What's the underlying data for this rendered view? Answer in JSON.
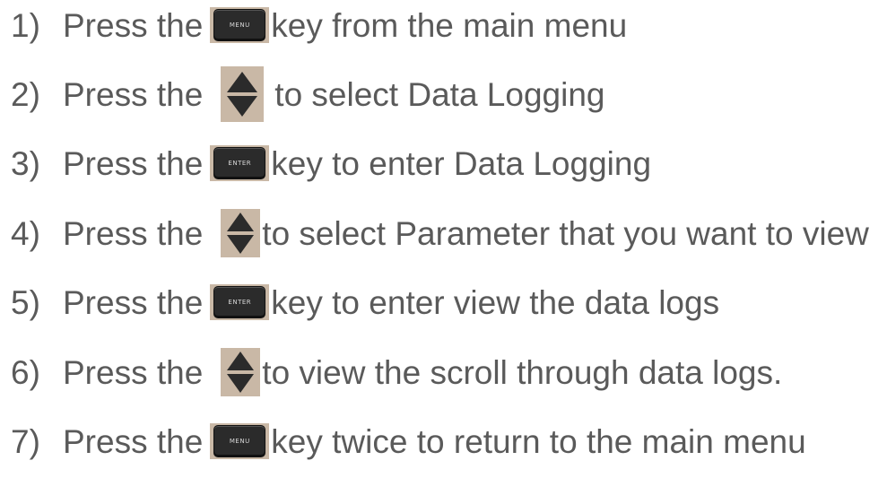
{
  "steps": [
    {
      "number": "1)",
      "pre": "Press the",
      "key_icon": "menu-key",
      "key_label": "MENU",
      "post": "key from the main menu"
    },
    {
      "number": "2)",
      "pre": "Press the",
      "key_icon": "up-down-arrow-key",
      "key_label": "",
      "post": "to select Data Logging"
    },
    {
      "number": "3)",
      "pre": "Press the",
      "key_icon": "enter-key",
      "key_label": "ENTER",
      "post": "key to enter Data Logging"
    },
    {
      "number": "4)",
      "pre": "Press the",
      "key_icon": "up-down-arrow-key",
      "key_label": "",
      "post": "to select Parameter that you want to view"
    },
    {
      "number": "5)",
      "pre": "Press the",
      "key_icon": "enter-key",
      "key_label": "ENTER",
      "post": "key to enter view the data logs"
    },
    {
      "number": "6)",
      "pre": "Press the",
      "key_icon": "up-down-arrow-key",
      "key_label": "",
      "post": "to view the scroll through data logs."
    },
    {
      "number": "7)",
      "pre": "Press the",
      "key_icon": "menu-key",
      "key_label": "MENU",
      "post": "key twice to return to the main menu"
    }
  ],
  "colors": {
    "text": "#5a5a5a",
    "key_background": "#c9b8a6",
    "key_face": "#2b2b2b"
  }
}
